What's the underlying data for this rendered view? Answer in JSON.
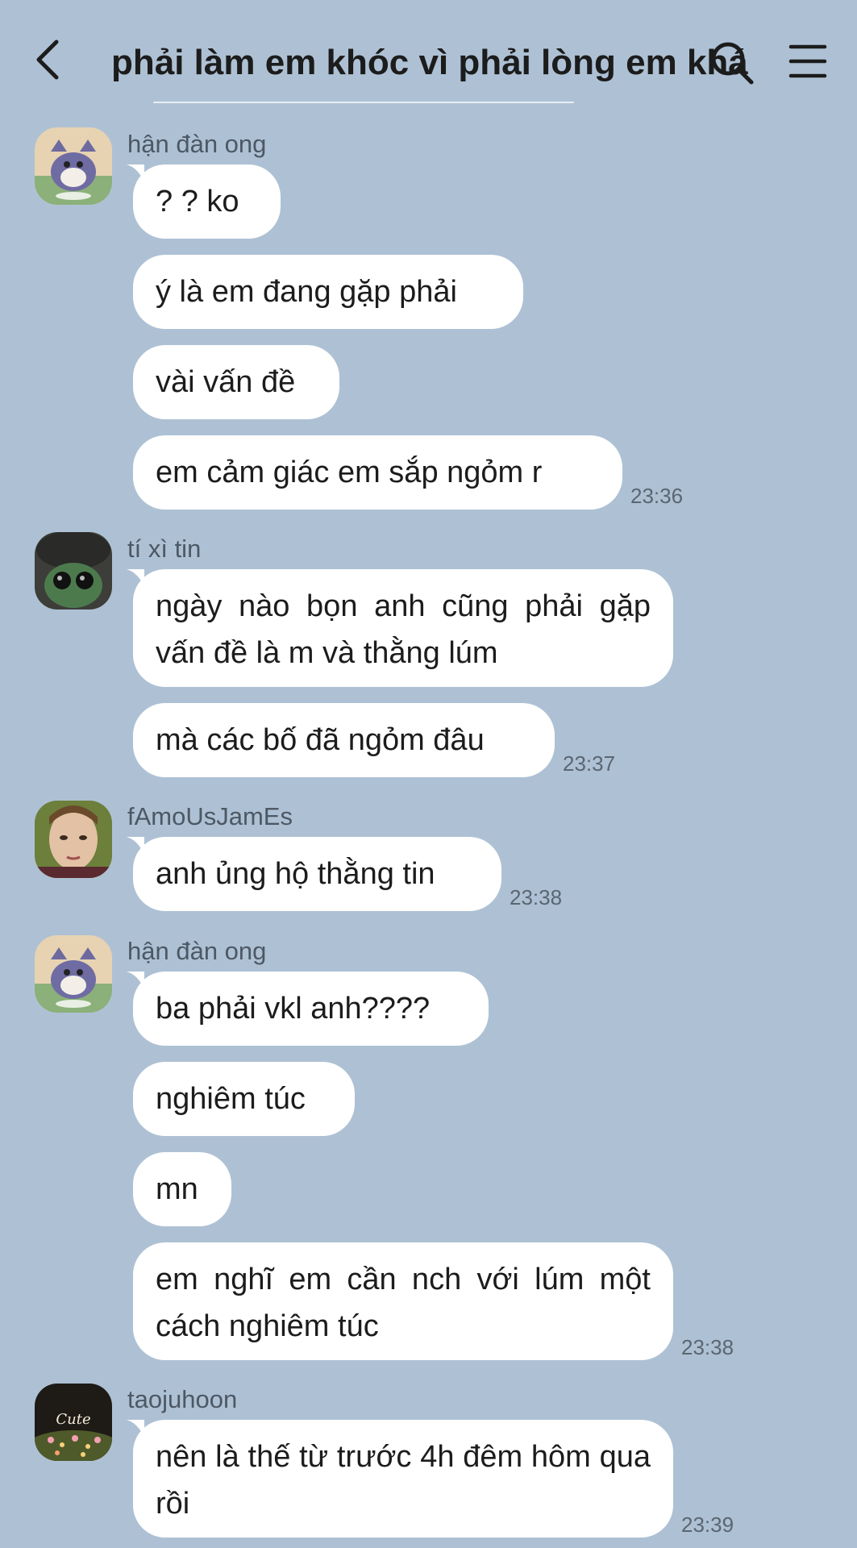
{
  "header": {
    "title": "phải làm em khóc vì phải lòng em khác",
    "back_icon": "chevron-left-icon",
    "search_icon": "search-icon",
    "menu_icon": "hamburger-menu-icon"
  },
  "colors": {
    "background": "#aec1d4",
    "bubble": "#ffffff",
    "text": "#1c1c1c",
    "sender": "#4d5865",
    "timestamp": "#5a6672"
  },
  "senders": {
    "s1": "hận đàn ong",
    "s2": "tí xì tin",
    "s3": "fAmoUsJamEs",
    "s4": "hận đàn ong",
    "s5": "taojuhoon"
  },
  "messages": {
    "m1": "? ? ko",
    "m2": "ý là em đang gặp phải",
    "m3": "vài vấn đề",
    "m4": "em cảm giác em sắp ngỏm r",
    "m5": "ngày nào bọn anh cũng phải gặp vấn đề là m và thằng lúm",
    "m6": "mà các bố đã ngỏm đâu",
    "m7": "anh ủng hộ thằng tin",
    "m8": "ba phải vkl anh????",
    "m9": "nghiêm túc",
    "m10": "mn",
    "m11": "em nghĩ em cần nch với lúm một cách nghiêm túc",
    "m12": "nên là thế từ trước 4h đêm hôm qua rồi"
  },
  "times": {
    "t1": "23:36",
    "t2": "23:37",
    "t3": "23:38",
    "t4": "23:38",
    "t5": "23:39"
  }
}
